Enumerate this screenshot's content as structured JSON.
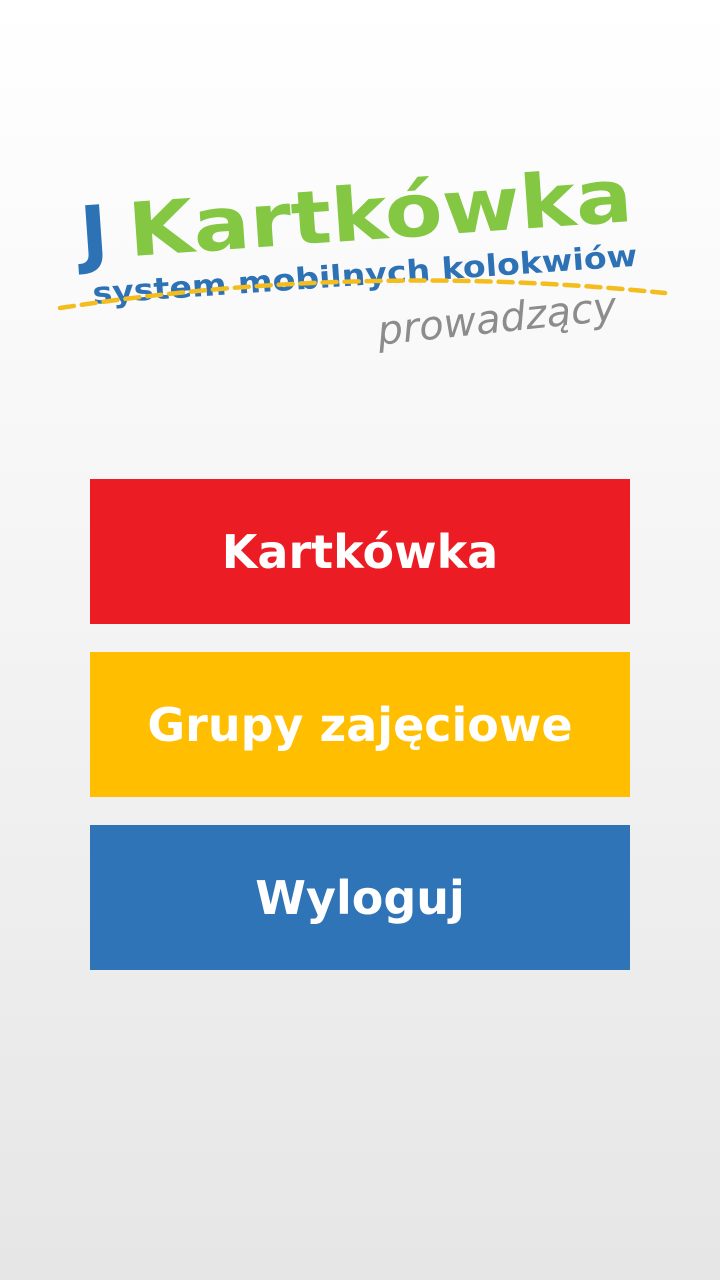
{
  "logo": {
    "letter_j": "J",
    "word": "Kartkówka",
    "tagline": "system mobilnych kolokwiów",
    "role": "prowadzący"
  },
  "menu": {
    "kartkowka_label": "Kartkówka",
    "grupy_label": "Grupy zajęciowe",
    "wyloguj_label": "Wyloguj"
  },
  "colors": {
    "logo_blue": "#2e72b6",
    "logo_green": "#83c742",
    "logo_gold": "#f2bd1d",
    "role_gray": "#8c8c8c",
    "kartkowka_button": "#ec1c24",
    "grupy_button": "#ffbe00",
    "wyloguj_button": "#2e74b7"
  }
}
